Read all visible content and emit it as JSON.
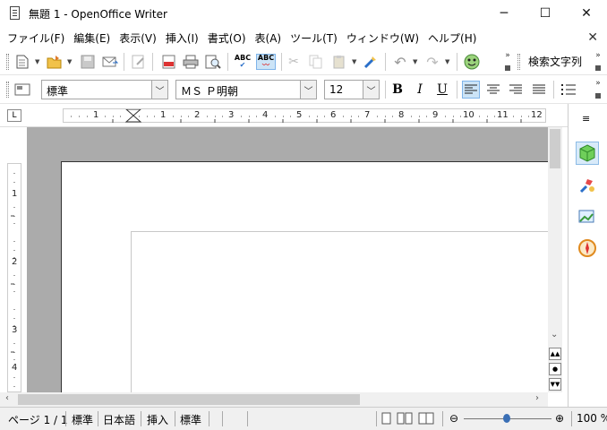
{
  "window": {
    "title": "無題 1 - OpenOffice Writer",
    "minimize_glyph": "─",
    "maximize_glyph": "☐",
    "close_glyph": "✕"
  },
  "menu": {
    "items": [
      "ファイル(F)",
      "編集(E)",
      "表示(V)",
      "挿入(I)",
      "書式(O)",
      "表(A)",
      "ツール(T)",
      "ウィンドウ(W)",
      "ヘルプ(H)"
    ],
    "close_doc_glyph": "✕"
  },
  "standard_toolbar": {
    "search_label": "検索文字列",
    "spellcheck_label": "ABC",
    "autospell_label": "ABC"
  },
  "format_toolbar": {
    "paragraph_style": "標準",
    "font_name": "ＭＳ Ｐ明朝",
    "font_size": "12",
    "bold": "B",
    "italic": "I",
    "underline": "U"
  },
  "ruler": {
    "corner_glyph": "L",
    "h_labels": [
      "1",
      "1",
      "2",
      "3",
      "4",
      "5",
      "6",
      "7",
      "8",
      "9",
      "10",
      "11",
      "12"
    ],
    "v_labels": [
      "1",
      "2",
      "3",
      "4"
    ]
  },
  "status": {
    "page": "ページ 1 / 1",
    "page_style": "標準",
    "language": "日本語",
    "insert_mode": "挿入",
    "selection_mode": "標準",
    "zoom": "100 %"
  },
  "colors": {
    "accent": "#3a6fb5",
    "doc_background": "#ababab",
    "active_button": "#cce4f7"
  }
}
